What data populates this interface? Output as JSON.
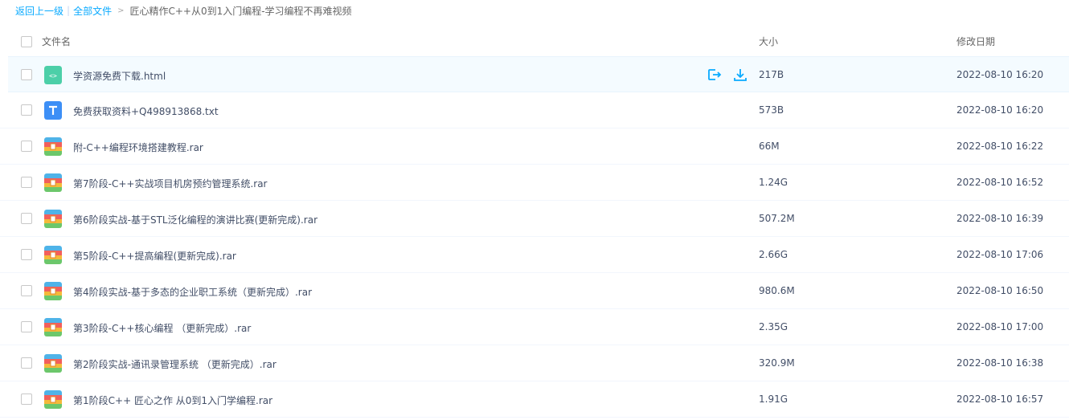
{
  "breadcrumb": {
    "back": "返回上一级",
    "separator": "|",
    "all_files": "全部文件",
    "arrow": ">",
    "current": "匠心精作C++从0到1入门编程-学习编程不再难视频"
  },
  "columns": {
    "name": "文件名",
    "size": "大小",
    "modified": "修改日期"
  },
  "colors": {
    "link": "#09aaff",
    "hover_row": "#f4fbff",
    "html_icon": "#4ccfa8",
    "txt_icon": "#3d8ff6",
    "action_icon": "#09aaff"
  },
  "files": [
    {
      "name": "学资源免费下载.html",
      "size": "217B",
      "date": "2022-08-10 16:20",
      "icon": "html-file-icon"
    },
    {
      "name": "免费获取资料+Q498913868.txt",
      "size": "573B",
      "date": "2022-08-10 16:20",
      "icon": "txt-file-icon"
    },
    {
      "name": "附-C++编程环境搭建教程.rar",
      "size": "66M",
      "date": "2022-08-10 16:22",
      "icon": "rar-file-icon"
    },
    {
      "name": "第7阶段-C++实战项目机房预约管理系统.rar",
      "size": "1.24G",
      "date": "2022-08-10 16:52",
      "icon": "rar-file-icon"
    },
    {
      "name": "第6阶段实战-基于STL泛化编程的演讲比赛(更新完成).rar",
      "size": "507.2M",
      "date": "2022-08-10 16:39",
      "icon": "rar-file-icon"
    },
    {
      "name": "第5阶段-C++提高编程(更新完成).rar",
      "size": "2.66G",
      "date": "2022-08-10 17:06",
      "icon": "rar-file-icon"
    },
    {
      "name": "第4阶段实战-基于多态的企业职工系统（更新完成）.rar",
      "size": "980.6M",
      "date": "2022-08-10 16:50",
      "icon": "rar-file-icon"
    },
    {
      "name": "第3阶段-C++核心编程 （更新完成）.rar",
      "size": "2.35G",
      "date": "2022-08-10 17:00",
      "icon": "rar-file-icon"
    },
    {
      "name": "第2阶段实战-通讯录管理系统 （更新完成）.rar",
      "size": "320.9M",
      "date": "2022-08-10 16:38",
      "icon": "rar-file-icon"
    },
    {
      "name": "第1阶段C++ 匠心之作 从0到1入门学编程.rar",
      "size": "1.91G",
      "date": "2022-08-10 16:57",
      "icon": "rar-file-icon"
    }
  ]
}
